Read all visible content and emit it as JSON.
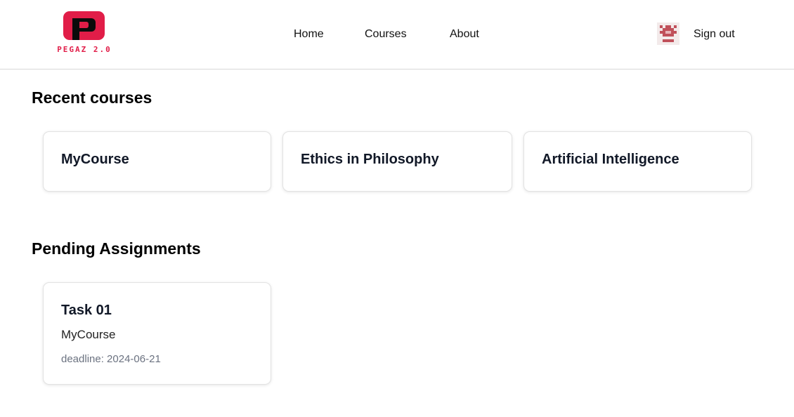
{
  "brand": {
    "logo_text": "PEGAZ 2.0",
    "accent_color": "#e11d48"
  },
  "nav": {
    "items": [
      {
        "label": "Home"
      },
      {
        "label": "Courses"
      },
      {
        "label": "About"
      }
    ]
  },
  "user": {
    "avatar_icon": "pixel-avatar-icon",
    "signout_label": "Sign out"
  },
  "recent_courses": {
    "title": "Recent courses",
    "items": [
      {
        "name": "MyCourse"
      },
      {
        "name": "Ethics in Philosophy"
      },
      {
        "name": "Artificial Intelligence"
      }
    ]
  },
  "pending_assignments": {
    "title": "Pending Assignments",
    "items": [
      {
        "name": "Task 01",
        "course": "MyCourse",
        "deadline": "deadline: 2024-06-21"
      }
    ]
  }
}
